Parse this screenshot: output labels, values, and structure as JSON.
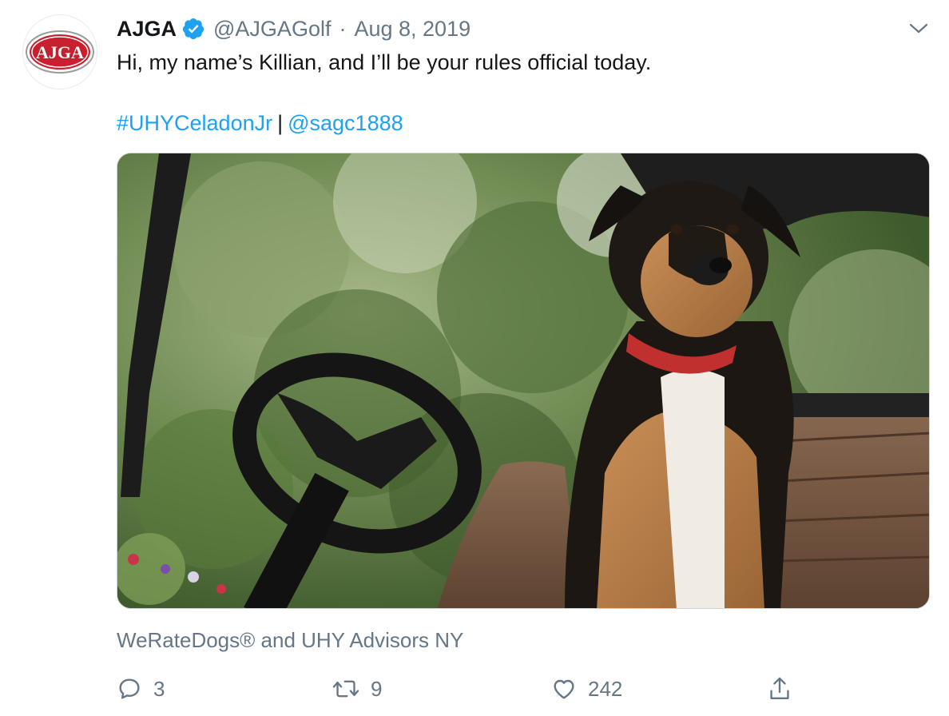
{
  "tweet": {
    "author": {
      "name": "AJGA",
      "handle": "@AJGAGolf",
      "avatar_text": "AJGA",
      "verified": true
    },
    "separator": "·",
    "date": "Aug 8, 2019",
    "text": "Hi, my name’s Killian, and I’ll be your rules official today.",
    "hashtag": "#UHYCeladonJr",
    "divider": "|",
    "mention": "@sagc1888",
    "tagged_users": "WeRateDogs® and UHY Advisors NY",
    "stats": {
      "replies": "3",
      "retweets": "9",
      "likes": "242"
    }
  },
  "colors": {
    "link": "#1da1f2",
    "muted": "#657786",
    "text": "#14171a",
    "logo_red": "#c8202f"
  },
  "icons": {
    "verified": "verified-badge-icon",
    "caret": "chevron-down-icon",
    "reply": "reply-icon",
    "retweet": "retweet-icon",
    "like": "heart-icon",
    "share": "share-icon",
    "tag": "person-tag-icon"
  }
}
